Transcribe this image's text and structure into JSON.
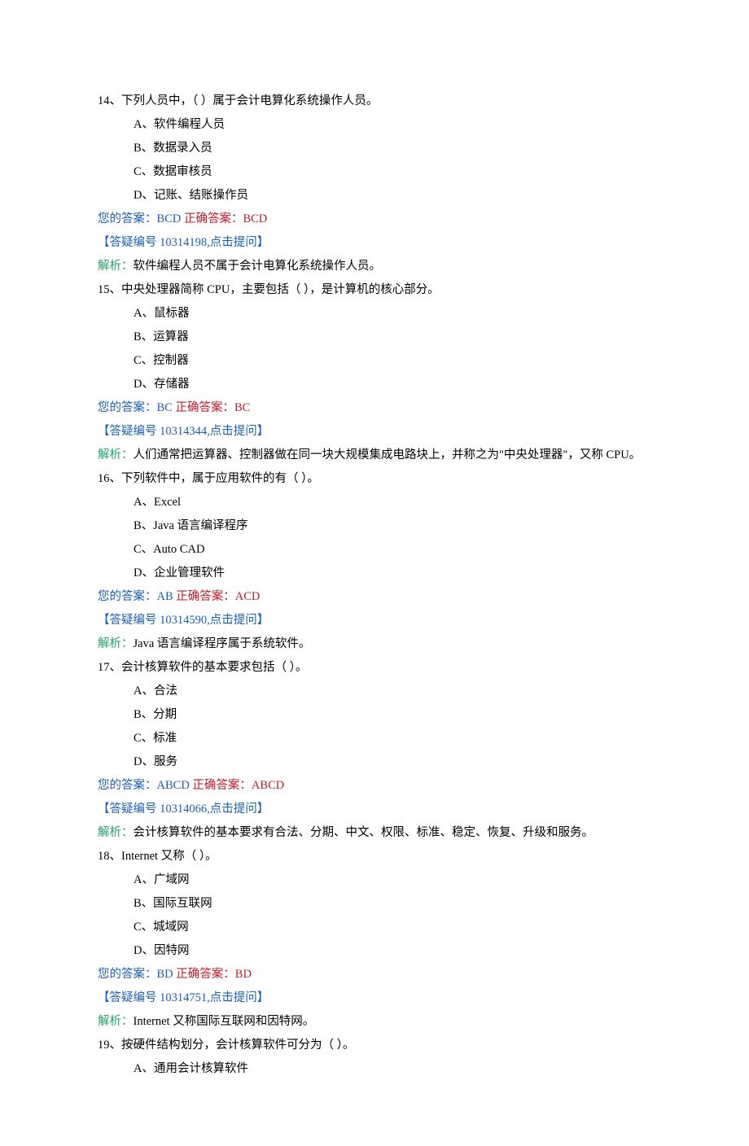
{
  "labels": {
    "your_answer": "您的答案：",
    "correct_answer": "正确答案：",
    "analysis": "解析：",
    "faq_prefix": "【答疑编号 ",
    "faq_suffix": ",点击提问】"
  },
  "questions": [
    {
      "num": "14",
      "stem": "、下列人员中，（ ）属于会计电算化系统操作人员。",
      "opts": [
        "A、软件编程人员",
        "B、数据录入员",
        "C、数据审核员",
        "D、记账、结账操作员"
      ],
      "your": "BCD",
      "correct": "BCD",
      "faq": "10314198",
      "jx": "软件编程人员不属于会计电算化系统操作人员。"
    },
    {
      "num": "15",
      "stem": "、中央处理器简称 CPU，主要包括（ ），是计算机的核心部分。",
      "opts": [
        "A、鼠标器",
        "B、运算器",
        "C、控制器",
        "D、存储器"
      ],
      "your": "BC",
      "correct": "BC",
      "faq": "10314344",
      "jx": "人们通常把运算器、控制器做在同一块大规模集成电路块上，并称之为\"中央处理器\"，又称 CPU。"
    },
    {
      "num": "16",
      "stem": "、下列软件中，属于应用软件的有（ ）。",
      "opts": [
        "A、Excel",
        "B、Java 语言编译程序",
        "C、Auto CAD",
        "D、企业管理软件"
      ],
      "your": "AB",
      "correct": "ACD",
      "faq": "10314590",
      "jx": "Java 语言编译程序属于系统软件。"
    },
    {
      "num": "17",
      "stem": "、会计核算软件的基本要求包括（ ）。",
      "opts": [
        "A、合法",
        "B、分期",
        "C、标准",
        "D、服务"
      ],
      "your": "ABCD",
      "correct": "ABCD",
      "faq": "10314066",
      "jx": "会计核算软件的基本要求有合法、分期、中文、权限、标准、稳定、恢复、升级和服务。"
    },
    {
      "num": "18",
      "stem": "、Internet 又称（ ）。",
      "opts": [
        "A、广域网",
        "B、国际互联网",
        "C、城域网",
        "D、因特网"
      ],
      "your": "BD",
      "correct": "BD",
      "faq": "10314751",
      "jx": "Internet 又称国际互联网和因特网。"
    },
    {
      "num": "19",
      "stem": "、按硬件结构划分，会计核算软件可分为（ ）。",
      "opts": [
        "A、通用会计核算软件"
      ],
      "your": null,
      "correct": null,
      "faq": null,
      "jx": null
    }
  ]
}
